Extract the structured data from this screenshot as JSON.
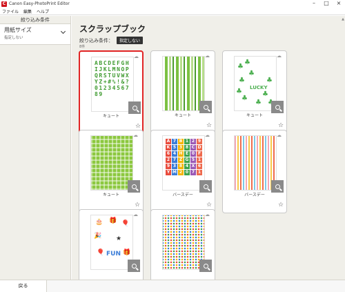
{
  "window": {
    "title": "Canon Easy-PhotoPrint Editor",
    "app_icon_letter": "C",
    "minimize": "–",
    "maximize": "□",
    "close": "×"
  },
  "menu": [
    "ファイル",
    "編集",
    "ヘルプ"
  ],
  "sidebar": {
    "header": "絞り込み条件",
    "filter_label": "用紙サイズ",
    "filter_value": "指定しない"
  },
  "main": {
    "title": "スクラップブック",
    "condition_label": "絞り込み条件：",
    "condition_value": "指定しない",
    "count": "8件"
  },
  "templates": [
    {
      "caption": "キュート",
      "art": "alphabet",
      "selected": true
    },
    {
      "caption": "キュート",
      "art": "stripes",
      "selected": false
    },
    {
      "caption": "キュート",
      "art": "clover",
      "selected": false
    },
    {
      "caption": "キュート",
      "art": "plaid",
      "selected": false
    },
    {
      "caption": "バースデー",
      "art": "blocks",
      "selected": false
    },
    {
      "caption": "バースデー",
      "art": "vstripes",
      "selected": false
    },
    {
      "caption": "",
      "art": "party",
      "selected": false
    },
    {
      "caption": "",
      "art": "dots",
      "selected": false
    }
  ],
  "art_text": {
    "alphabet": "ABCDEFGHIJKLMNOPQRSTUVWXYZ+#%!&?0123456789",
    "clover_word": "LUCKY",
    "party_word": "FUN",
    "blocks": [
      "A",
      "7",
      "B",
      "1",
      "2",
      "9",
      "K",
      "5",
      "3",
      "8",
      "C",
      "D",
      "6",
      "4",
      "H",
      "E",
      "0",
      "F",
      "2",
      "7",
      "Z",
      "G",
      "5",
      "1",
      "9",
      "3",
      "8",
      "4",
      "X",
      "6",
      "Y",
      "M",
      "2",
      "0",
      "7",
      "1"
    ]
  },
  "icons": {
    "zoom": "zoom-icon",
    "favorite": "star-icon",
    "cloud": "cloud-download-icon",
    "chevron": "chevron-down-icon"
  },
  "colors": {
    "selection": "#e12424",
    "background": "#f0efe9",
    "badge": "#333333"
  },
  "footer": {
    "back_label": "戻る"
  }
}
